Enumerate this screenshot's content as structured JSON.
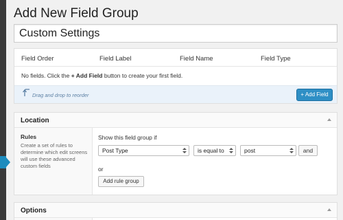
{
  "page": {
    "title": "Add New Field Group",
    "group_title_value": "Custom Settings"
  },
  "fields": {
    "columns": [
      "Field Order",
      "Field Label",
      "Field Name",
      "Field Type"
    ],
    "empty_prefix": "No fields. Click the ",
    "empty_link": "+ Add Field",
    "empty_suffix": " button to create your first field.",
    "drag_hint": "Drag and drop to reorder",
    "add_button": "+ Add Field"
  },
  "location": {
    "title": "Location",
    "rules_label": "Rules",
    "rules_desc": "Create a set of rules to determine which edit screens will use these advanced custom fields",
    "show_if": "Show this field group if",
    "param": "Post Type",
    "operator": "is equal to",
    "value": "post",
    "and_label": "and",
    "or_label": "or",
    "add_rule_group": "Add rule group"
  },
  "options": {
    "title": "Options"
  },
  "colors": {
    "primary": "#2e8fc5",
    "admin_menu": "#3a3a3a",
    "menu_highlight": "#1e8cbe",
    "footer_bg": "#eaf2fa"
  }
}
